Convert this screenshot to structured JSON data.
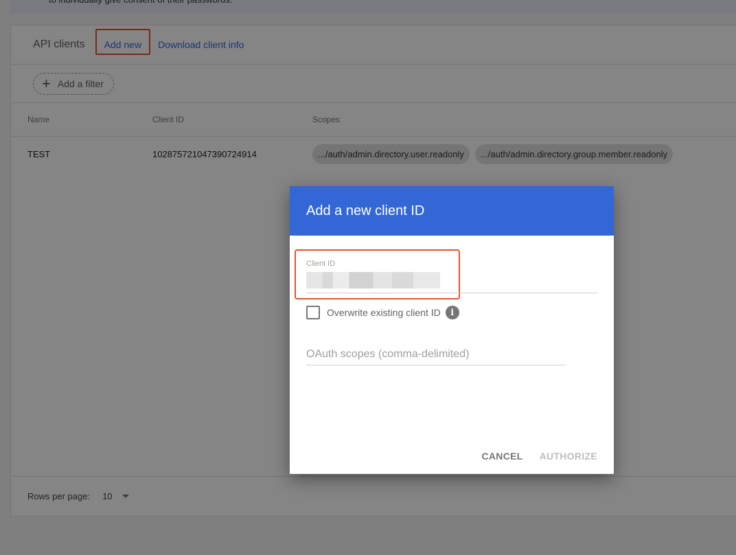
{
  "notice": {
    "text": "to individually give consent of their passwords."
  },
  "card": {
    "title": "API clients",
    "add_new": "Add new",
    "download": "Download client info",
    "filter_label": "Add a filter",
    "columns": [
      "Name",
      "Client ID",
      "Scopes"
    ],
    "rows": [
      {
        "name": "TEST",
        "client_id": "102875721047390724914",
        "scopes": [
          ".../auth/admin.directory.user.readonly",
          ".../auth/admin.directory.group.member.readonly"
        ]
      }
    ],
    "footer": {
      "rows_per_page_label": "Rows per page:",
      "rows_per_page_value": "10"
    }
  },
  "dialog": {
    "title": "Add a new client ID",
    "client_id_label": "Client ID",
    "client_id_value": "",
    "overwrite_label": "Overwrite existing client ID",
    "info_icon": "i",
    "scopes_placeholder": "OAuth scopes (comma-delimited)",
    "cancel": "CANCEL",
    "authorize": "AUTHORIZE"
  },
  "colors": {
    "accent": "#3367d6",
    "highlight": "#e5502b"
  }
}
